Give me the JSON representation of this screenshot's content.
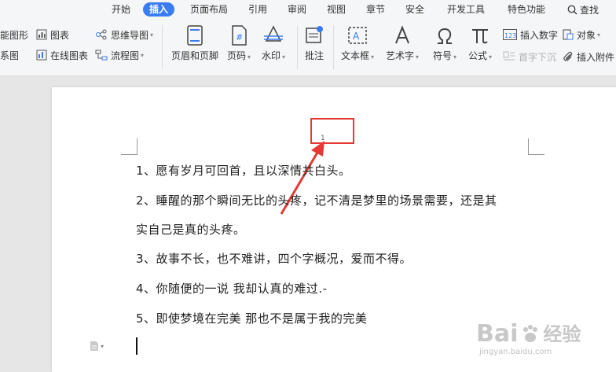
{
  "tabs": [
    "开始",
    "插入",
    "页面布局",
    "引用",
    "审阅",
    "视图",
    "章节",
    "安全",
    "开发工具",
    "特色功能"
  ],
  "active_tab": "插入",
  "search_label": "查找",
  "ribbon": {
    "shapes_partial": "能图形",
    "relations_partial": "系图",
    "chart": "图表",
    "online_chart": "在线图表",
    "mindmap": "思维导图",
    "flowchart": "流程图",
    "header_footer": "页眉和页脚",
    "page_number": "页码",
    "watermark": "水印",
    "comment": "批注",
    "textbox": "文本框",
    "wordart": "艺术字",
    "symbol": "符号",
    "formula": "公式",
    "insert_number": "插入数字",
    "object": "对象",
    "drop_cap": "首字下沉",
    "attachment": "插入附件"
  },
  "document": {
    "page_number_text": "1",
    "lines": [
      "1、愿有岁月可回首，且以深情共白头。",
      "2、睡醒的那个瞬间无比的头疼，记不清是梦里的场景需要，还是其",
      "实自己是真的头疼。",
      "3、故事不长，也不难讲，四个字概况，爱而不得。",
      "4、你随便的一说  我却认真的难过.-",
      "5、即使梦境在完美  那也不是属于我的完美"
    ]
  },
  "watermark": {
    "brand": "Bai",
    "brand_cn": "经验",
    "url": "jingyan.baidu.com"
  },
  "colors": {
    "accent": "#3b7cf4",
    "highlight": "#e53935"
  }
}
